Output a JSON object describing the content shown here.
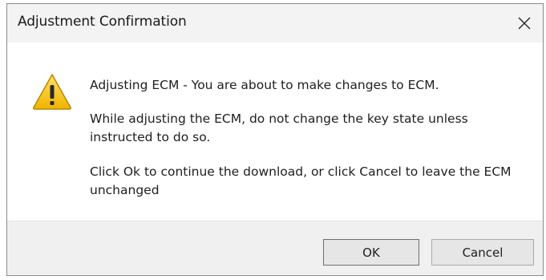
{
  "window": {
    "title": "Adjustment Confirmation",
    "close_glyph": "close-icon"
  },
  "message": {
    "icon": "warning-icon",
    "line1": "Adjusting ECM - You are about to make changes to ECM.",
    "line2": "While adjusting the ECM, do not change the key state unless instructed to do so.",
    "line3": "Click Ok to continue the download, or click Cancel to leave the ECM unchanged"
  },
  "buttons": {
    "ok_label": "OK",
    "cancel_label": "Cancel"
  },
  "colors": {
    "warning_fill": "#f5c518",
    "warning_border": "#c08a00",
    "titlebar_bg": "#f3f3f3",
    "footer_bg": "#f0f0f0"
  }
}
